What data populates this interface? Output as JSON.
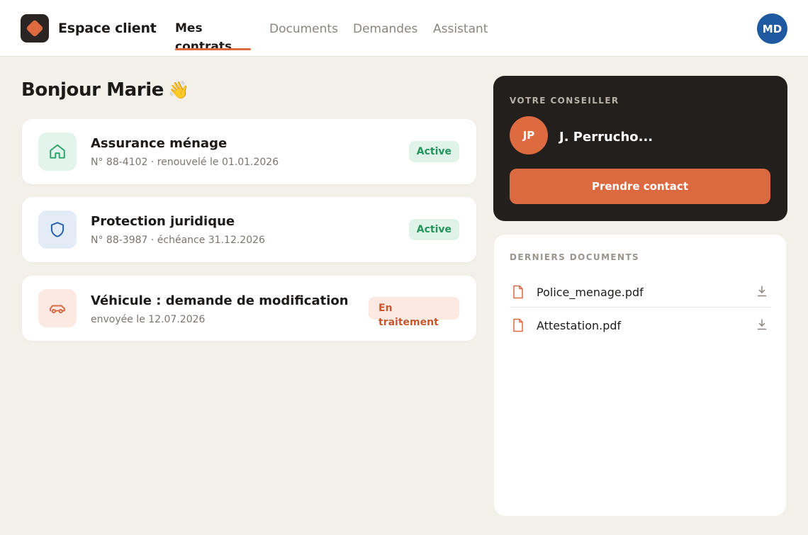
{
  "header": {
    "brand": "Espace client",
    "nav": [
      "Mes contrats",
      "Documents",
      "Demandes",
      "Assistant"
    ],
    "active_tab": "Mes contrats",
    "user_initials": "MD"
  },
  "greeting": {
    "text": "Bonjour Marie",
    "emoji": "👋"
  },
  "contracts": [
    {
      "icon": "home-icon",
      "title": "Assurance ménage",
      "subtitle": "N° 88-4102 · renouvelé le 01.01.2026",
      "status": "Active"
    },
    {
      "icon": "shield-icon",
      "title": "Protection juridique",
      "subtitle": "N° 88-3987 · échéance 31.12.2026",
      "status": "Active"
    },
    {
      "icon": "car-icon",
      "title": "Véhicule : demande de modification",
      "subtitle": "envoyée le 12.07.2026",
      "status": "En traitement"
    }
  ],
  "advisor": {
    "label": "VOTRE CONSEILLER",
    "initials": "JP",
    "name": "J. Perrucho...",
    "button": "Prendre contact"
  },
  "documents": {
    "label": "DERNIERS DOCUMENTS",
    "items": [
      {
        "name": "Police_menage.pdf"
      },
      {
        "name": "Attestation.pdf"
      }
    ]
  },
  "colors": {
    "accent": "#de6a40",
    "background": "#f3f0e9",
    "active_badge": "#24935c",
    "pending_badge": "#c9572d",
    "avatar_user": "#1f5aa0",
    "dark_panel": "#221f1c"
  }
}
